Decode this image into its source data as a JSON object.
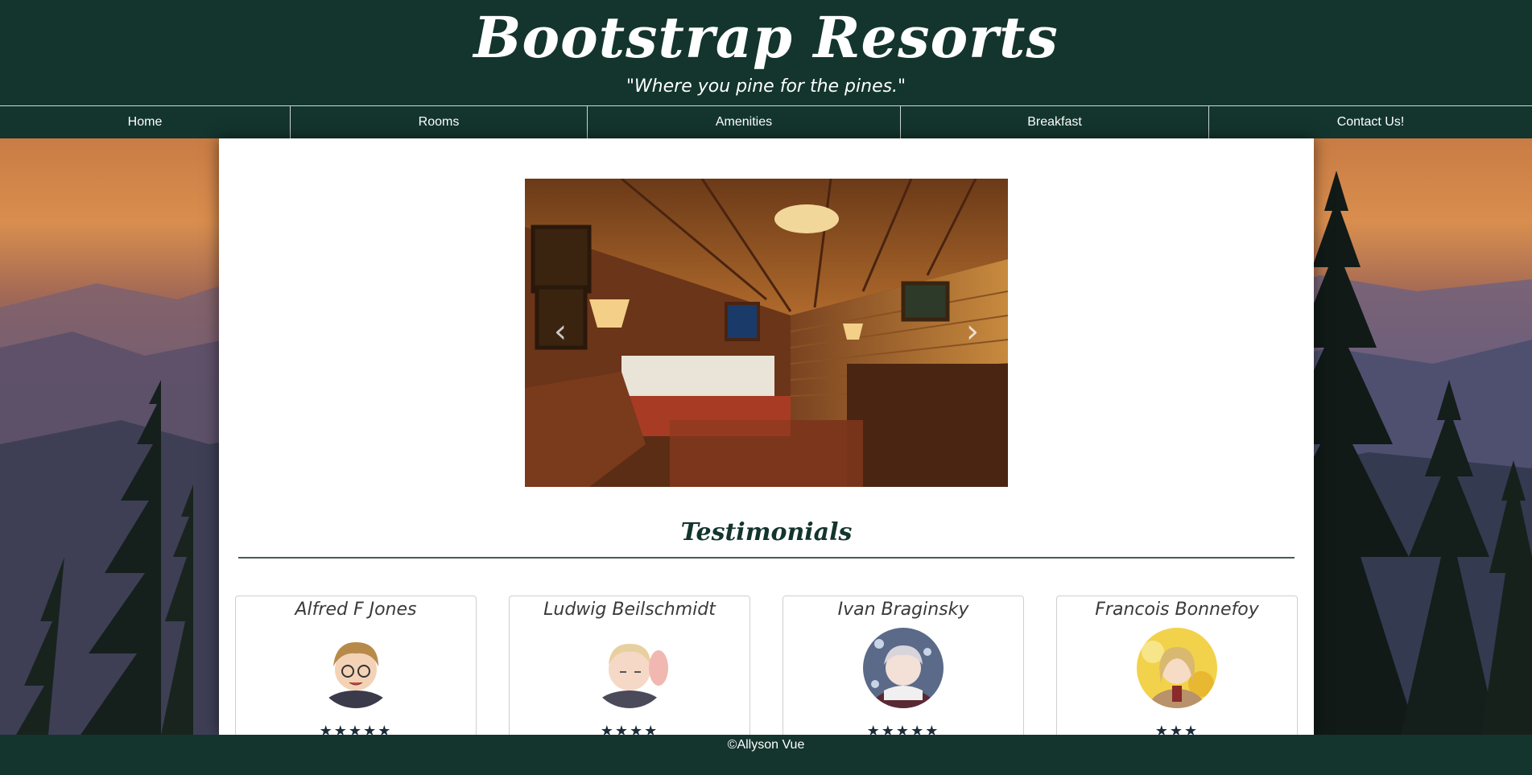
{
  "site": {
    "title": "Bootstrap Resorts",
    "tagline": "\"Where you pine for the pines.\""
  },
  "nav": {
    "items": [
      {
        "label": "Home"
      },
      {
        "label": "Rooms"
      },
      {
        "label": "Amenities"
      },
      {
        "label": "Breakfast"
      },
      {
        "label": "Contact Us!"
      }
    ]
  },
  "carousel": {
    "prev_icon": "chevron-left-icon",
    "next_icon": "chevron-right-icon"
  },
  "testimonials": {
    "title": "Testimonials",
    "cards": [
      {
        "name": "Alfred F Jones",
        "stars": "★★★★★",
        "rating": 5
      },
      {
        "name": "Ludwig Beilschmidt",
        "stars": "★★★★",
        "rating": 4
      },
      {
        "name": "Ivan Braginsky",
        "stars": "★★★★★",
        "rating": 5
      },
      {
        "name": "Francois Bonnefoy",
        "stars": "★★★",
        "rating": 3
      }
    ]
  },
  "footer": {
    "text": "©Allyson Vue"
  },
  "colors": {
    "brand_dark_green": "#13352d",
    "content_bg": "#ffffff",
    "star_color": "#1a2c3a"
  }
}
